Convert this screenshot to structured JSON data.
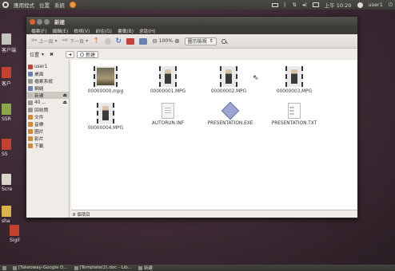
{
  "top_panel": {
    "menu": [
      "應用程式",
      "位置",
      "系統"
    ],
    "tray": {
      "clock": "上午 10:20",
      "user": "user1"
    }
  },
  "desktop_icons": [
    {
      "label": "客户端",
      "color": "#c7c3bd"
    },
    {
      "label": "客户",
      "color": "#c4402f"
    },
    {
      "label": "SSR",
      "color": "#8aa84a"
    },
    {
      "label": "SS",
      "color": "#c4402f"
    },
    {
      "label": "Scre",
      "color": "#d8d4cc"
    },
    {
      "label": "sha",
      "color": "#d8b34a"
    },
    {
      "label": "Sigil",
      "color": "#c4402f"
    }
  ],
  "window": {
    "title": "新建",
    "menubar": [
      "檔案(F)",
      "編輯(E)",
      "檢視(V)",
      "前往(G)",
      "書籤(B)",
      "求助(H)"
    ],
    "toolbar": {
      "back_label": "上一頁",
      "forward_label": "下一頁",
      "zoom_level": "100%",
      "view_mode": "圖示檢視"
    },
    "location": {
      "label": "位置",
      "crumb": "新建"
    },
    "sidebar": [
      {
        "label": "user1",
        "icon": "home-folder-icon",
        "color": "#c6413d",
        "eject": false,
        "selected": false
      },
      {
        "label": "桌面",
        "icon": "desktop-folder-icon",
        "color": "#6b7fb3",
        "eject": false,
        "selected": false
      },
      {
        "label": "檔案系統",
        "icon": "filesystem-icon",
        "color": "#9a9892",
        "eject": false,
        "selected": false
      },
      {
        "label": "網絡",
        "icon": "network-icon",
        "color": "#6b7fb3",
        "eject": false,
        "selected": false
      },
      {
        "label": "新建",
        "icon": "optical-drive-icon",
        "color": "#bdbab4",
        "eject": true,
        "selected": true
      },
      {
        "label": "40 ...",
        "icon": "hard-drive-icon",
        "color": "#9a9892",
        "eject": true,
        "selected": false
      },
      {
        "label": "回收筒",
        "icon": "trash-icon",
        "color": "#9a9892",
        "eject": false,
        "selected": false
      },
      {
        "label": "文件",
        "icon": "documents-folder-icon",
        "color": "#d08a3a",
        "eject": false,
        "selected": false
      },
      {
        "label": "音樂",
        "icon": "music-folder-icon",
        "color": "#d08a3a",
        "eject": false,
        "selected": false
      },
      {
        "label": "圖片",
        "icon": "pictures-folder-icon",
        "color": "#d08a3a",
        "eject": false,
        "selected": false
      },
      {
        "label": "影片",
        "icon": "videos-folder-icon",
        "color": "#d08a3a",
        "eject": false,
        "selected": false
      },
      {
        "label": "下載",
        "icon": "downloads-folder-icon",
        "color": "#d08a3a",
        "eject": false,
        "selected": false
      }
    ],
    "files": [
      {
        "name": "00000000.mpg",
        "icon": "video-thumbnail-icon"
      },
      {
        "name": "00000001.MPG",
        "icon": "video-thumbnail-icon"
      },
      {
        "name": "00000002.MPG",
        "icon": "video-thumbnail-icon"
      },
      {
        "name": "00000003.MPG",
        "icon": "video-thumbnail-icon"
      },
      {
        "name": "00000004.MPG",
        "icon": "video-thumbnail-icon"
      },
      {
        "name": "AUTORUN.INF",
        "icon": "text-document-icon"
      },
      {
        "name": "PRESENTATION.EXE",
        "icon": "executable-icon"
      },
      {
        "name": "PRESENTATION.TXT",
        "icon": "text-file-icon"
      }
    ],
    "status": "8 個項目"
  },
  "taskbar": [
    {
      "label": "[Takeoway-Google D..."
    },
    {
      "label": "[Template(2).doc - Lib..."
    },
    {
      "label": "新建"
    }
  ],
  "colors": {
    "panel": "#3c3b37",
    "window_bg": "#efebe7",
    "close_button": "#e35e2b"
  }
}
